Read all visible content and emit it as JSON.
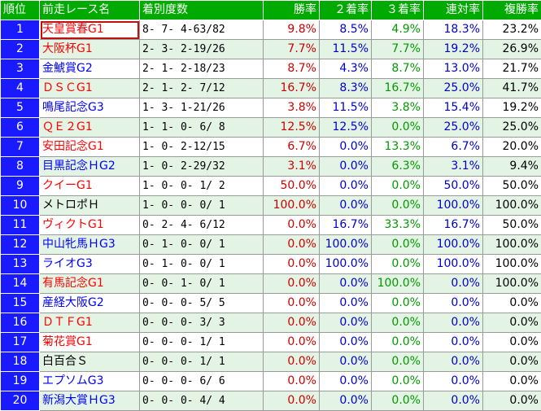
{
  "headers": {
    "rank": "順位",
    "race": "前走レース名",
    "record": "着別度数",
    "win": "勝率",
    "second": "２着率",
    "third": "３着率",
    "rentai": "連対率",
    "fukusho": "複勝率"
  },
  "colors": {
    "header_bg": "#00aa00",
    "rank_bg": "#1a1aff",
    "grade_red": "#ff0000",
    "race_blue": "#0000ff",
    "win": "#cc0000",
    "second": "#0000cc",
    "third": "#009900"
  },
  "rows": [
    {
      "rank": "1",
      "race": "天皇賞春G1",
      "race_color": "red",
      "record": "8- 7- 4-63/82",
      "win": "9.8%",
      "second": "8.5%",
      "third": "4.9%",
      "rentai": "18.3%",
      "fukusho": "23.2%"
    },
    {
      "rank": "2",
      "race": "大阪杯G1",
      "race_color": "red",
      "record": "2- 3- 2-19/26",
      "win": "7.7%",
      "second": "11.5%",
      "third": "7.7%",
      "rentai": "19.2%",
      "fukusho": "26.9%"
    },
    {
      "rank": "3",
      "race": "金鯱賞G2",
      "race_color": "blue",
      "record": "2- 1- 2-18/23",
      "win": "8.7%",
      "second": "4.3%",
      "third": "8.7%",
      "rentai": "13.0%",
      "fukusho": "21.7%"
    },
    {
      "rank": "4",
      "race": "ＤＳＣG1",
      "race_color": "red",
      "record": "2- 1- 2- 7/12",
      "win": "16.7%",
      "second": "8.3%",
      "third": "16.7%",
      "rentai": "25.0%",
      "fukusho": "41.7%"
    },
    {
      "rank": "5",
      "race": "鳴尾記念G3",
      "race_color": "blue",
      "record": "1- 3- 1-21/26",
      "win": "3.8%",
      "second": "11.5%",
      "third": "3.8%",
      "rentai": "15.4%",
      "fukusho": "19.2%"
    },
    {
      "rank": "6",
      "race": "ＱＥ２G1",
      "race_color": "red",
      "record": "1- 1- 0- 6/ 8",
      "win": "12.5%",
      "second": "12.5%",
      "third": "0.0%",
      "rentai": "25.0%",
      "fukusho": "25.0%"
    },
    {
      "rank": "7",
      "race": "安田記念G1",
      "race_color": "red",
      "record": "1- 0- 2-12/15",
      "win": "6.7%",
      "second": "0.0%",
      "third": "13.3%",
      "rentai": "6.7%",
      "fukusho": "20.0%"
    },
    {
      "rank": "8",
      "race": "目黒記念ＨG2",
      "race_color": "blue",
      "record": "1- 0- 2-29/32",
      "win": "3.1%",
      "second": "0.0%",
      "third": "6.3%",
      "rentai": "3.1%",
      "fukusho": "9.4%"
    },
    {
      "rank": "9",
      "race": "クイーG1",
      "race_color": "red",
      "record": "1- 0- 0- 1/ 2",
      "win": "50.0%",
      "second": "0.0%",
      "third": "0.0%",
      "rentai": "50.0%",
      "fukusho": "50.0%"
    },
    {
      "rank": "10",
      "race": "メトロポＨ",
      "race_color": "black",
      "record": "1- 0- 0- 0/ 1",
      "win": "100.0%",
      "second": "0.0%",
      "third": "0.0%",
      "rentai": "100.0%",
      "fukusho": "100.0%"
    },
    {
      "rank": "11",
      "race": "ヴィクトG1",
      "race_color": "red",
      "record": "0- 2- 4- 6/12",
      "win": "0.0%",
      "second": "16.7%",
      "third": "33.3%",
      "rentai": "16.7%",
      "fukusho": "50.0%"
    },
    {
      "rank": "12",
      "race": "中山牝馬ＨG3",
      "race_color": "blue",
      "record": "0- 1- 0- 0/ 1",
      "win": "0.0%",
      "second": "100.0%",
      "third": "0.0%",
      "rentai": "100.0%",
      "fukusho": "100.0%"
    },
    {
      "rank": "13",
      "race": "ライオG3",
      "race_color": "blue",
      "record": "0- 1- 0- 0/ 1",
      "win": "0.0%",
      "second": "100.0%",
      "third": "0.0%",
      "rentai": "100.0%",
      "fukusho": "100.0%"
    },
    {
      "rank": "14",
      "race": "有馬記念G1",
      "race_color": "red",
      "record": "0- 0- 1- 0/ 1",
      "win": "0.0%",
      "second": "0.0%",
      "third": "100.0%",
      "rentai": "0.0%",
      "fukusho": "100.0%"
    },
    {
      "rank": "15",
      "race": "産経大阪G2",
      "race_color": "blue",
      "record": "0- 0- 0- 5/ 5",
      "win": "0.0%",
      "second": "0.0%",
      "third": "0.0%",
      "rentai": "0.0%",
      "fukusho": "0.0%"
    },
    {
      "rank": "16",
      "race": "ＤＴＦG1",
      "race_color": "red",
      "record": "0- 0- 0- 3/ 3",
      "win": "0.0%",
      "second": "0.0%",
      "third": "0.0%",
      "rentai": "0.0%",
      "fukusho": "0.0%"
    },
    {
      "rank": "17",
      "race": "菊花賞G1",
      "race_color": "red",
      "record": "0- 0- 0- 1/ 1",
      "win": "0.0%",
      "second": "0.0%",
      "third": "0.0%",
      "rentai": "0.0%",
      "fukusho": "0.0%"
    },
    {
      "rank": "18",
      "race": "白百合Ｓ",
      "race_color": "black",
      "record": "0- 0- 0- 1/ 1",
      "win": "0.0%",
      "second": "0.0%",
      "third": "0.0%",
      "rentai": "0.0%",
      "fukusho": "0.0%"
    },
    {
      "rank": "19",
      "race": "エプソムG3",
      "race_color": "blue",
      "record": "0- 0- 0- 6/ 6",
      "win": "0.0%",
      "second": "0.0%",
      "third": "0.0%",
      "rentai": "0.0%",
      "fukusho": "0.0%"
    },
    {
      "rank": "20",
      "race": "新潟大賞ＨG3",
      "race_color": "blue",
      "record": "0- 0- 0- 4/ 4",
      "win": "0.0%",
      "second": "0.0%",
      "third": "0.0%",
      "rentai": "0.0%",
      "fukusho": "0.0%"
    }
  ]
}
